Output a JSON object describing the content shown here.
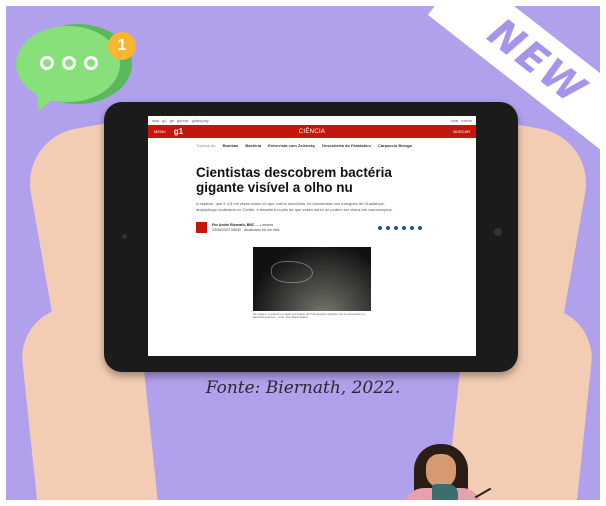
{
  "ribbon": {
    "text": "NEW"
  },
  "notification": {
    "count": "1"
  },
  "browser_topbar": {
    "links": [
      "ossi",
      "g1",
      "ge",
      "gshow",
      "globoplay"
    ],
    "right_links": [
      "criar",
      "entrar"
    ]
  },
  "site_header": {
    "menu_label": "MENU",
    "logo": "g1",
    "section": "CIÊNCIA",
    "search_label": "BUSCAR"
  },
  "topics": {
    "lead": "Tópicos do",
    "items": [
      "Bombas",
      "Bactéria",
      "Entrevista com Zelensky",
      "Descoberta do Fantástico",
      "Carpaccio Beluga"
    ]
  },
  "article": {
    "headline": "Cientistas descobrem bactéria gigante visível a olho nu",
    "summary": "A espécie, que é 4,5 mil vezes maior do que outros micróbios, foi encontrada nos mangues de Guadalupe, arquipélago localizado no Caribe, e desafia a noção de que esses seres só podem ser vistos em microscópios.",
    "author": "Por André Biernath, BBC",
    "location": "Londres",
    "date": "23/06/2022 08h30 · Atualizado há um mês",
    "photo_caption": "Na imagem, é possível ver vários exemplares da Thiomargarita magnifica, que se assemelham a filamentos brancos — Foto: Jean-Marie Volland"
  },
  "share_icons": [
    "facebook-icon",
    "twitter-icon",
    "whatsapp-icon",
    "pinterest-icon",
    "linkedin-icon",
    "share-icon"
  ],
  "source_text": "Fonte: Biernath, 2022."
}
